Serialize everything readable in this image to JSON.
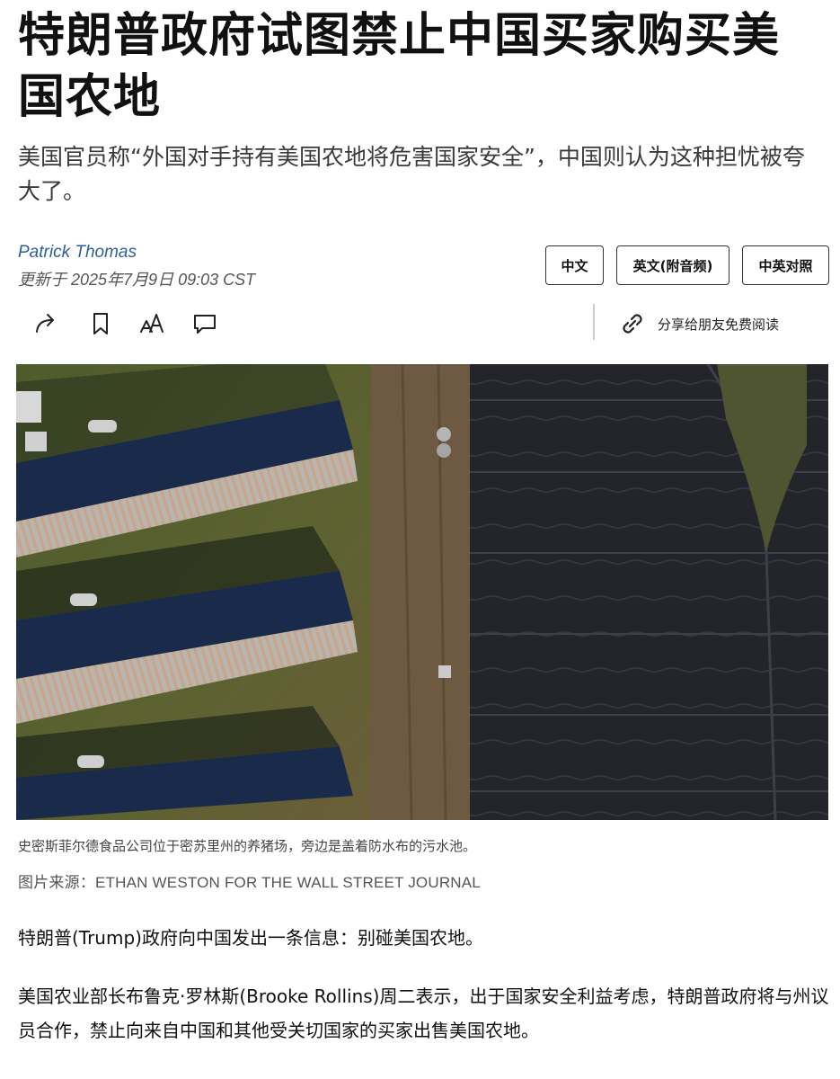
{
  "article": {
    "headline": "特朗普政府试图禁止中国买家购买美国农地",
    "dek": "美国官员称“外国对手持有美国农地将危害国家安全”，中国则认为这种担忧被夸大了。",
    "author": "Patrick Thomas",
    "updated": "更新于 2025年7月9日 09:03 CST"
  },
  "language_buttons": [
    "中文",
    "英文(附音频)",
    "中英对照"
  ],
  "toolbar": {
    "icons": [
      "share-icon",
      "bookmark-icon",
      "text-size-icon",
      "comment-icon"
    ],
    "gift_icon": "link-icon",
    "gift_label": "分享给朋友免费阅读"
  },
  "photo": {
    "caption": "史密斯菲尔德食品公司位于密苏里州的养猪场，旁边是盖着防水布的污水池。",
    "credit": "图片来源：ETHAN WESTON FOR THE WALL STREET JOURNAL"
  },
  "body": {
    "paragraphs": [
      "特朗普(Trump)政府向中国发出一条信息：别碰美国农地。",
      "美国农业部长布鲁克·罗林斯(Brooke Rollins)周二表示，出于国家安全利益考虑，特朗普政府将与州议员合作，禁止向来自中国和其他受关切国家的买家出售美国农地。"
    ]
  }
}
